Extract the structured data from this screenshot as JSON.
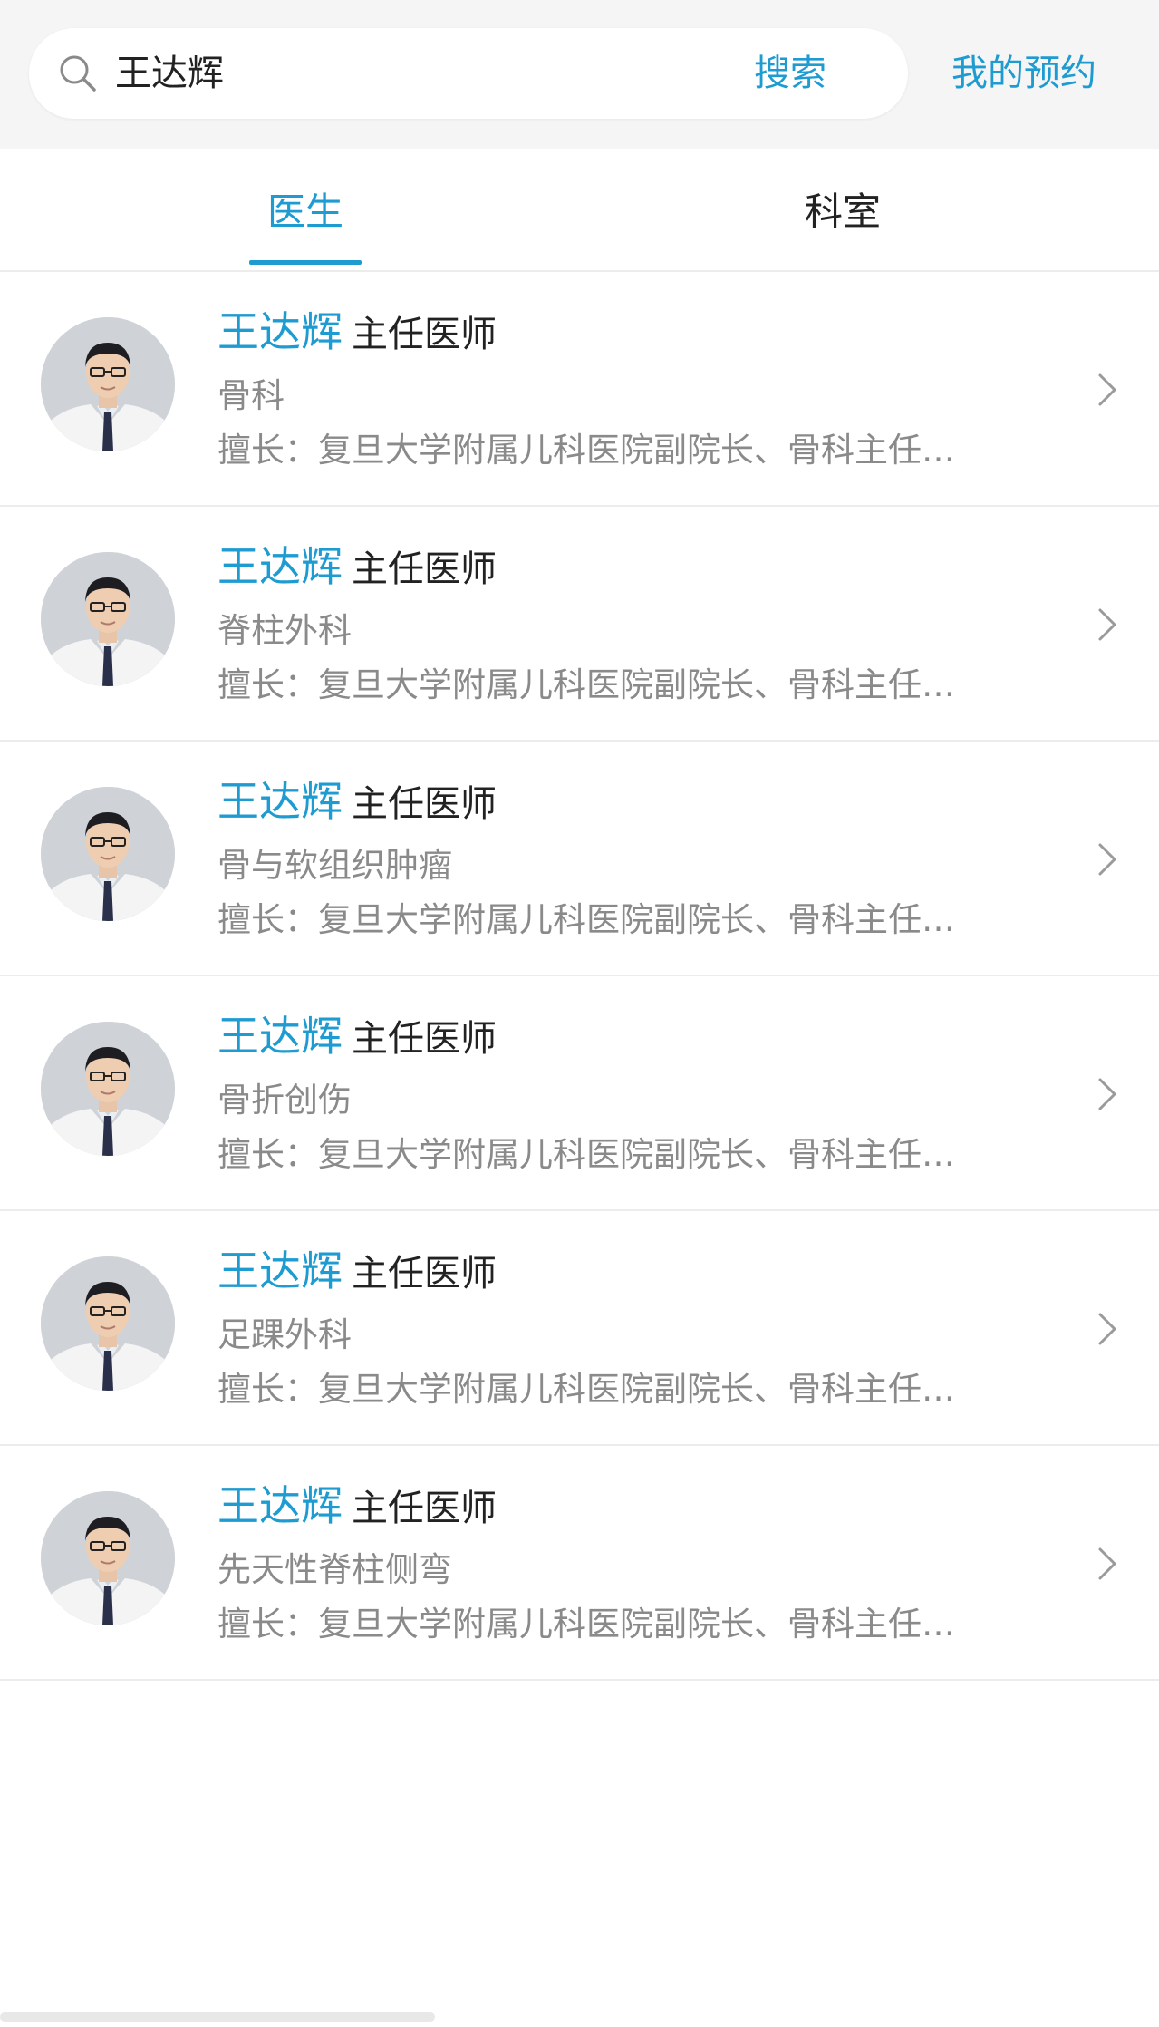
{
  "search": {
    "query": "王达辉",
    "button_label": "搜索",
    "icon": "search-icon"
  },
  "header": {
    "my_booking_label": "我的预约"
  },
  "tabs": [
    {
      "label": "医生",
      "active": true
    },
    {
      "label": "科室",
      "active": false
    }
  ],
  "colors": {
    "accent": "#1e9bd0",
    "text_primary": "#222222",
    "text_secondary": "#8a8a8a",
    "divider": "#ececec",
    "background_top": "#f5f5f5"
  },
  "doctors": [
    {
      "name": "王达辉",
      "title": "主任医师",
      "department": "骨科",
      "specialty": "擅长：复旦大学附属儿科医院副院长、骨科主任…"
    },
    {
      "name": "王达辉",
      "title": "主任医师",
      "department": "脊柱外科",
      "specialty": "擅长：复旦大学附属儿科医院副院长、骨科主任…"
    },
    {
      "name": "王达辉",
      "title": "主任医师",
      "department": "骨与软组织肿瘤",
      "specialty": "擅长：复旦大学附属儿科医院副院长、骨科主任…"
    },
    {
      "name": "王达辉",
      "title": "主任医师",
      "department": "骨折创伤",
      "specialty": "擅长：复旦大学附属儿科医院副院长、骨科主任…"
    },
    {
      "name": "王达辉",
      "title": "主任医师",
      "department": "足踝外科",
      "specialty": "擅长：复旦大学附属儿科医院副院长、骨科主任…"
    },
    {
      "name": "王达辉",
      "title": "主任医师",
      "department": "先天性脊柱侧弯",
      "specialty": "擅长：复旦大学附属儿科医院副院长、骨科主任…"
    }
  ]
}
